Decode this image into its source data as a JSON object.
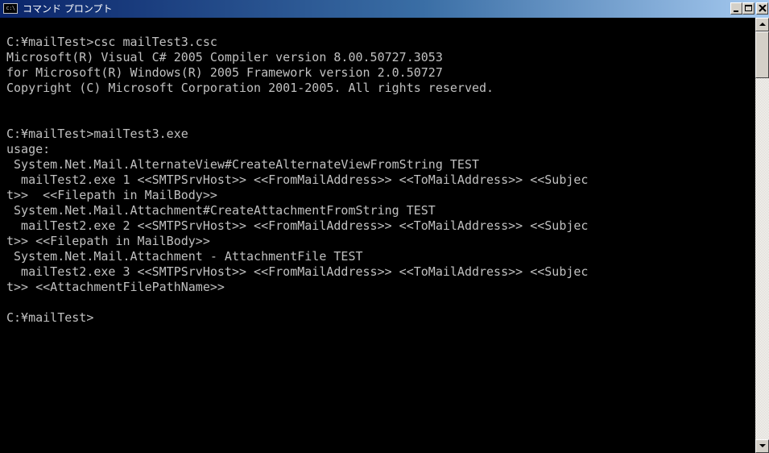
{
  "window": {
    "title": "コマンド プロンプト",
    "icon_label": "c:\\",
    "icon": "cmd-icon"
  },
  "console": {
    "lines": [
      "",
      "C:¥mailTest>csc mailTest3.csc",
      "Microsoft(R) Visual C# 2005 Compiler version 8.00.50727.3053",
      "for Microsoft(R) Windows(R) 2005 Framework version 2.0.50727",
      "Copyright (C) Microsoft Corporation 2001-2005. All rights reserved.",
      "",
      "",
      "C:¥mailTest>mailTest3.exe",
      "usage:",
      " System.Net.Mail.AlternateView#CreateAlternateViewFromString TEST",
      "  mailTest2.exe 1 <<SMTPSrvHost>> <<FromMailAddress>> <<ToMailAddress>> <<Subjec",
      "t>>  <<Filepath in MailBody>>",
      " System.Net.Mail.Attachment#CreateAttachmentFromString TEST",
      "  mailTest2.exe 2 <<SMTPSrvHost>> <<FromMailAddress>> <<ToMailAddress>> <<Subjec",
      "t>> <<Filepath in MailBody>>",
      " System.Net.Mail.Attachment - AttachmentFile TEST",
      "  mailTest2.exe 3 <<SMTPSrvHost>> <<FromMailAddress>> <<ToMailAddress>> <<Subjec",
      "t>> <<AttachmentFilePathName>>",
      "",
      "C:¥mailTest>"
    ]
  },
  "colors": {
    "console_background": "#000000",
    "console_text": "#c0c0c0",
    "titlebar_start": "#0a246a",
    "titlebar_end": "#a6caf0"
  }
}
